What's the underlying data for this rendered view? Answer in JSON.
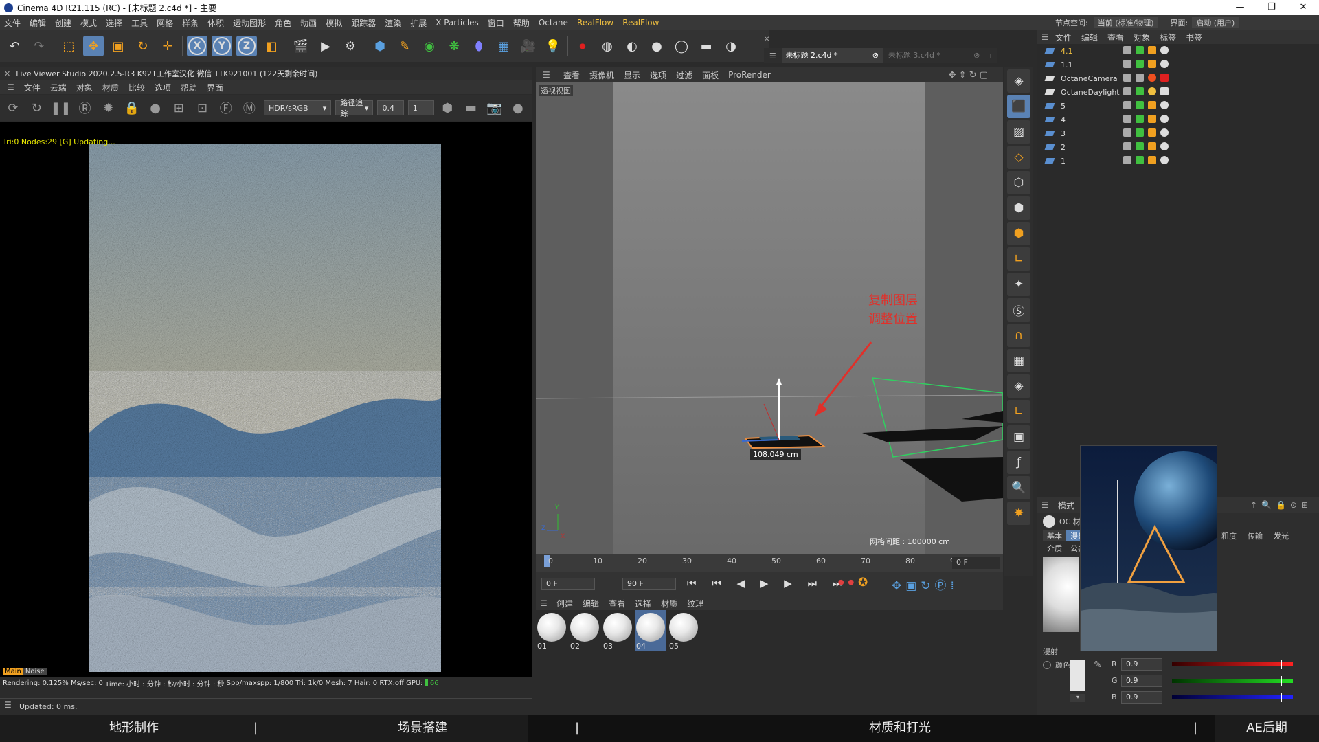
{
  "titlebar": {
    "title": "Cinema 4D R21.115 (RC) - [未标题 2.c4d *] - 主要",
    "min": "—",
    "max": "❐",
    "close": "✕"
  },
  "menubar": {
    "items": [
      "文件",
      "编辑",
      "创建",
      "模式",
      "选择",
      "工具",
      "网格",
      "样条",
      "体积",
      "运动图形",
      "角色",
      "动画",
      "模拟",
      "跟踪器",
      "渲染",
      "扩展",
      "X-Particles",
      "窗口",
      "帮助",
      "Octane"
    ],
    "realflow_1": "RealFlow",
    "realflow_2": "RealFlow"
  },
  "menuright": {
    "nodespace_label": "节点空间:",
    "nodespace_value": "当前 (标准/物理)",
    "layout_label": "界面:",
    "layout_value": "启动 (用户)"
  },
  "live_viewer": {
    "title": "Live Viewer Studio 2020.2.5-R3  K921工作室汉化 微信 TTK921001  (122天剩余时间)",
    "menu": [
      "文件",
      "云端",
      "对象",
      "材质",
      "比较",
      "选项",
      "帮助",
      "界面"
    ],
    "color_mode": "HDR/sRGB",
    "render_mode": "路径追踪",
    "value_1": "0.4",
    "value_2": "1",
    "info": "Tri:0 Nodes:29  [G] Updating...",
    "noise_label_1": "Main",
    "noise_label_2": "Noise",
    "status": {
      "rendering": "Rendering: 0.125%",
      "mssec": "Ms/sec: 0",
      "time": "Time: 小时 : 分钟 : 秒/小时 : 分钟 : 秒",
      "spp": "Spp/maxspp: 1/800",
      "tri": "Tri: 1k/0",
      "mesh": "Mesh: 7",
      "hair": "Hair: 0",
      "rtx": "RTX:off",
      "gpu": "GPU:",
      "gpu_val": "66"
    },
    "updated": "Updated: 0 ms."
  },
  "viewport": {
    "menu": [
      "查看",
      "摄像机",
      "显示",
      "选项",
      "过滤",
      "面板",
      "ProRender"
    ],
    "label": "透视视图",
    "measure": "108.049 cm",
    "grid": "网格间距 : 100000 cm",
    "annotation_line1": "复制图层",
    "annotation_line2": "调整位置",
    "axis_y": "Y",
    "axis_z": "Z",
    "axis_x": "X",
    "close_x": "✕"
  },
  "doc_tabs": [
    {
      "label": "未标题 2.c4d *",
      "close": "⊗"
    },
    {
      "label": "未标题 3.c4d *",
      "close": "⊗"
    },
    {
      "label": "+",
      "close": ""
    }
  ],
  "timeline": {
    "ticks": [
      "0",
      "10",
      "20",
      "30",
      "40",
      "50",
      "60",
      "70",
      "80",
      "90"
    ],
    "current": "0 F",
    "start": "0 F",
    "end": "90 F"
  },
  "material_bar": {
    "menu": [
      "创建",
      "编辑",
      "查看",
      "选择",
      "材质",
      "纹理"
    ],
    "materials": [
      "01",
      "02",
      "03",
      "04",
      "05"
    ],
    "selected": "04"
  },
  "object_manager": {
    "menu": [
      "文件",
      "编辑",
      "查看",
      "对象",
      "标签",
      "书签"
    ],
    "objects": [
      {
        "name": "4.1",
        "color": "#f0c040"
      },
      {
        "name": "1.1",
        "color": "#dddddd"
      },
      {
        "name": "OctaneCamera",
        "color": "#dddddd"
      },
      {
        "name": "OctaneDaylight",
        "color": "#dddddd"
      },
      {
        "name": "5",
        "color": "#dddddd"
      },
      {
        "name": "4",
        "color": "#dddddd"
      },
      {
        "name": "3",
        "color": "#dddddd"
      },
      {
        "name": "2",
        "color": "#dddddd"
      },
      {
        "name": "1",
        "color": "#dddddd"
      }
    ]
  },
  "attributes": {
    "mode": "模式",
    "material_name": "OC 材质",
    "tabs": [
      "基本",
      "漫射",
      "粗度",
      "传输",
      "发光"
    ],
    "subtabs": [
      "介质",
      "公共"
    ],
    "section": "漫射",
    "color_label": "颜色",
    "r_label": "R",
    "g_label": "G",
    "b_label": "B",
    "r": "0.9",
    "g": "0.9",
    "b": "0.9",
    "fill_r": 0.9,
    "fill_g": 0.9,
    "fill_b": 0.9
  },
  "bottombar": {
    "tabs": [
      "地形制作",
      "场景搭建",
      "材质和打光",
      "AE后期"
    ],
    "sep": "|"
  },
  "colors": {
    "accent": "#5a82b4",
    "annotation": "#e0302a",
    "info_text": "#e6e600"
  }
}
